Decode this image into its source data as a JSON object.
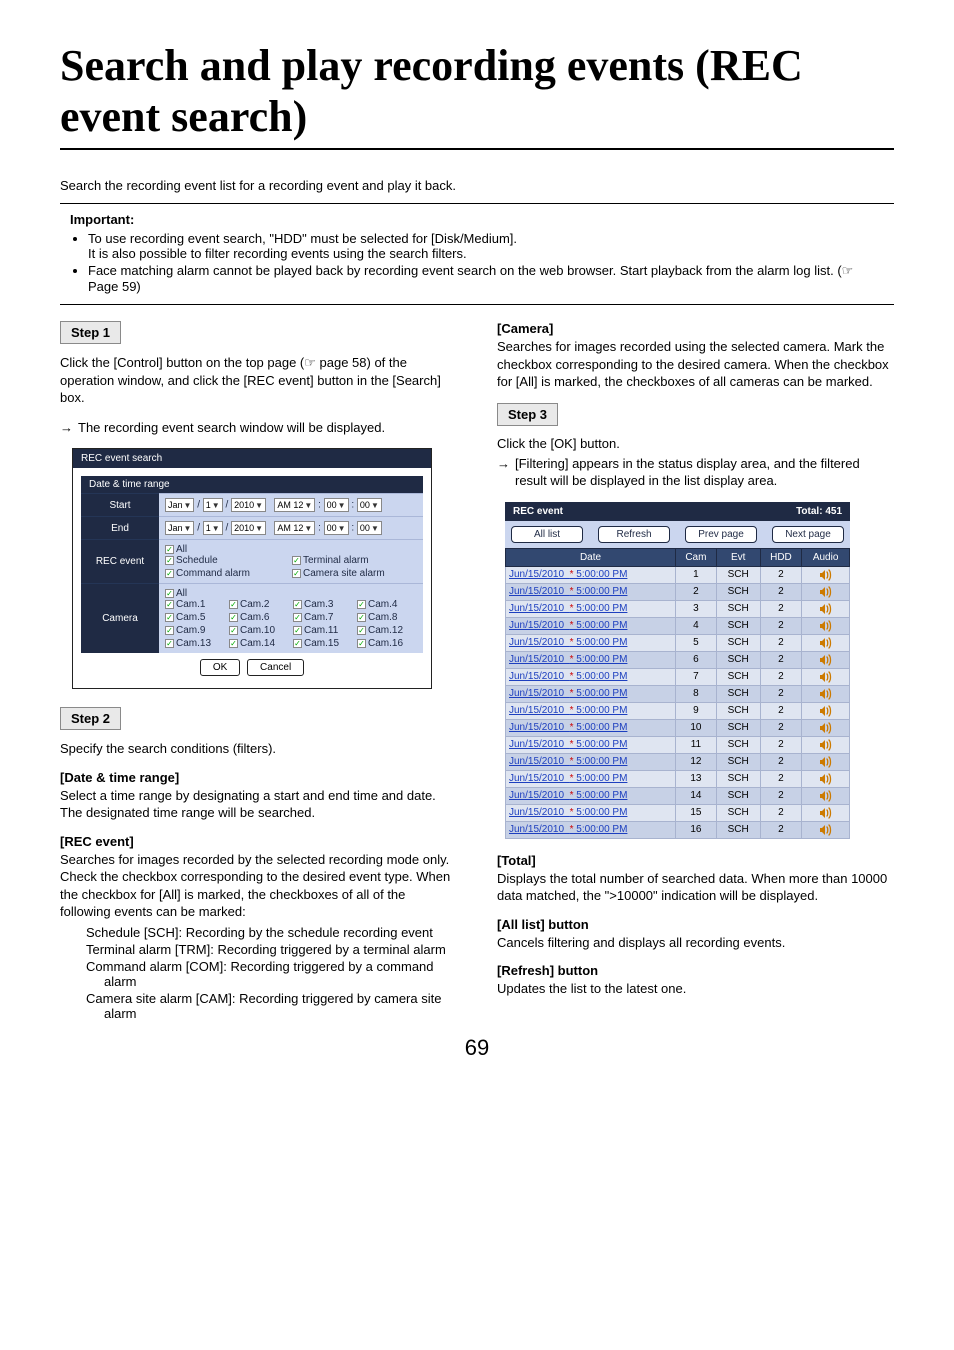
{
  "title": "Search and play recording events (REC event search)",
  "intro": "Search the recording event list for a recording event and play it back.",
  "important": {
    "heading": "Important:",
    "b1": "To use recording event search, \"HDD\" must be selected for [Disk/Medium].",
    "b1b": "It is also possible to filter recording events using the search filters.",
    "b2": "Face matching alarm cannot be played back by recording event search on the web browser. Start playback from the alarm log list. (☞ Page 59)"
  },
  "left": {
    "step1": {
      "label": "Step 1",
      "p1": "Click the [Control] button on the top page (☞ page 58) of the operation window, and click the [REC event] button in the [Search] box.",
      "arrow": "→",
      "p2": "The recording event search window will be displayed."
    },
    "step2": {
      "label": "Step 2",
      "p1": "Specify the search conditions (filters).",
      "dt_h": "[Date & time range]",
      "dt_p": "Select a time range by designating a start and end time and date. The designated time range will be searched.",
      "rec_h": "[REC event]",
      "rec_p": "Searches for images recorded by the selected recording mode only. Check the checkbox corresponding to the desired event type. When the checkbox for [All] is marked, the checkboxes of all of the following events can be marked:",
      "li1": "Schedule [SCH]: Recording by the schedule recording event",
      "li2": "Terminal alarm [TRM]: Recording triggered by a terminal alarm",
      "li3": "Command alarm [COM]: Recording triggered by a command alarm",
      "li4": "Camera site alarm [CAM]: Recording triggered by camera site alarm"
    }
  },
  "right": {
    "cam_h": "[Camera]",
    "cam_p": "Searches for images recorded using the selected camera. Mark the checkbox corresponding to the desired camera. When the checkbox for [All] is marked, the checkboxes of all cameras can be marked.",
    "step3": {
      "label": "Step 3",
      "p1": "Click the [OK] button.",
      "arrow": "→",
      "p2": "[Filtering] appears in the status display area, and the filtered result will be displayed in the list display area."
    },
    "total_h": "[Total]",
    "total_p": "Displays the total number of searched data. When more than 10000 data matched, the \">10000\" indication will be displayed.",
    "all_h": "[All list] button",
    "all_p": "Cancels filtering and displays all recording events.",
    "ref_h": "[Refresh] button",
    "ref_p": "Updates the list to the latest one."
  },
  "page_num": "69",
  "ss1": {
    "window_title": "REC event search",
    "section": "Date & time range",
    "row_start": "Start",
    "row_end": "End",
    "row_recevent": "REC event",
    "row_camera": "Camera",
    "month": "Jan",
    "day": "1",
    "year": "2010",
    "ampm": "AM 12",
    "mm": "00",
    "ss": "00",
    "slash": "/",
    "colon": ":",
    "all": "All",
    "cb_schedule": "Schedule",
    "cb_command": "Command alarm",
    "cb_terminal": "Terminal alarm",
    "cb_site": "Camera site alarm",
    "cam": [
      "Cam.1",
      "Cam.2",
      "Cam.3",
      "Cam.4",
      "Cam.5",
      "Cam.6",
      "Cam.7",
      "Cam.8",
      "Cam.9",
      "Cam.10",
      "Cam.11",
      "Cam.12",
      "Cam.13",
      "Cam.14",
      "Cam.15",
      "Cam.16"
    ],
    "ok": "OK",
    "cancel": "Cancel"
  },
  "ss2": {
    "head_left": "REC event",
    "head_right": "Total: 451",
    "btn_all": "All list",
    "btn_refresh": "Refresh",
    "btn_prev": "Prev page",
    "btn_next": "Next page",
    "col_date": "Date",
    "col_cam": "Cam",
    "col_evt": "Evt",
    "col_hdd": "HDD",
    "col_audio": "Audio",
    "date_text": "Jun/15/2010",
    "star": "*",
    "time_text": "5:00:00 PM",
    "evt_val": "SCH",
    "hdd_val": "2",
    "rows": 16
  }
}
